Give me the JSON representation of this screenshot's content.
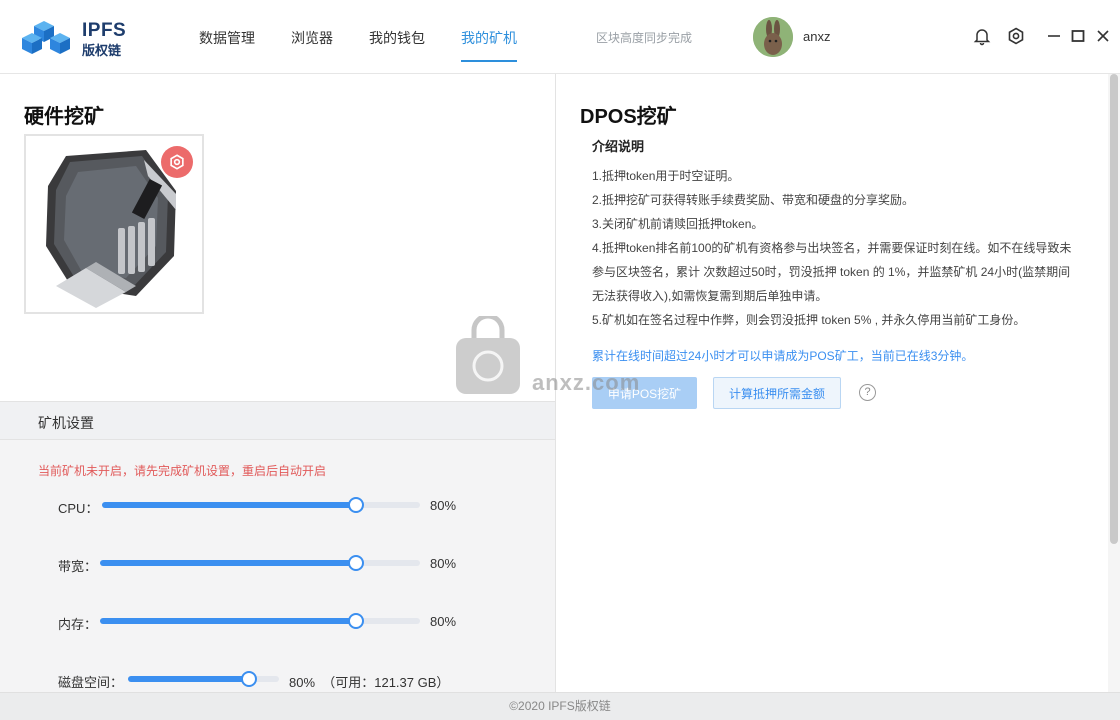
{
  "app": {
    "logo_line1": "IPFS",
    "logo_line2": "版权链"
  },
  "nav": {
    "items": [
      {
        "label": "数据管理"
      },
      {
        "label": "浏览器"
      },
      {
        "label": "我的钱包"
      },
      {
        "label": "我的矿机",
        "active": true
      }
    ]
  },
  "header": {
    "sync_status": "区块高度同步完成",
    "username": "anxz",
    "icons": [
      "bell-icon",
      "settings-icon",
      "minimize-icon",
      "maximize-icon",
      "close-icon"
    ]
  },
  "hardware": {
    "title": "硬件挖矿",
    "settings_title": "矿机设置",
    "warning": "当前矿机未开启，请先完成矿机设置，重启后自动开启",
    "sliders": [
      {
        "label": "CPU：",
        "percent": 80,
        "value_text": "80%"
      },
      {
        "label": "带宽：",
        "percent": 80,
        "value_text": "80%"
      },
      {
        "label": "内存：",
        "percent": 80,
        "value_text": "80%"
      },
      {
        "label": "磁盘空间：",
        "percent": 80,
        "value_text": "80%  （可用：121.37 GB）"
      }
    ]
  },
  "dpos": {
    "title": "DPOS挖矿",
    "intro_title": "介绍说明",
    "intro_lines": [
      "1.抵押token用于时空证明。",
      "2.抵押挖矿可获得转账手续费奖励、带宽和硬盘的分享奖励。",
      "3.关闭矿机前请赎回抵押token。",
      "4.抵押token排名前100的矿机有资格参与出块签名，并需要保证时刻在线。如不在线导致未",
      "参与区块签名，累计 次数超过50时，罚没抵押 token 的 1%，并监禁矿机 24小时(监禁期间",
      "无法获得收入),如需恢复需到期后单独申请。",
      "5.矿机如在签名过程中作弊，则会罚没抵押 token 5% , 并永久停用当前矿工身份。"
    ],
    "online_note": "累计在线时间超过24小时才可以申请成为POS矿工，当前已在线3分钟。",
    "apply_button": "申请POS挖矿",
    "calc_button": "计算抵押所需金额",
    "help_symbol": "?"
  },
  "watermark": {
    "text": "anxz.com"
  },
  "footer": {
    "copyright": "©2020 IPFS版权链"
  },
  "colors": {
    "accent": "#2d8fdc",
    "slider": "#3b8ff0",
    "warning": "#e15a5a",
    "gear_badge": "#ec6b6b",
    "logo_blue": "#2e86de"
  }
}
